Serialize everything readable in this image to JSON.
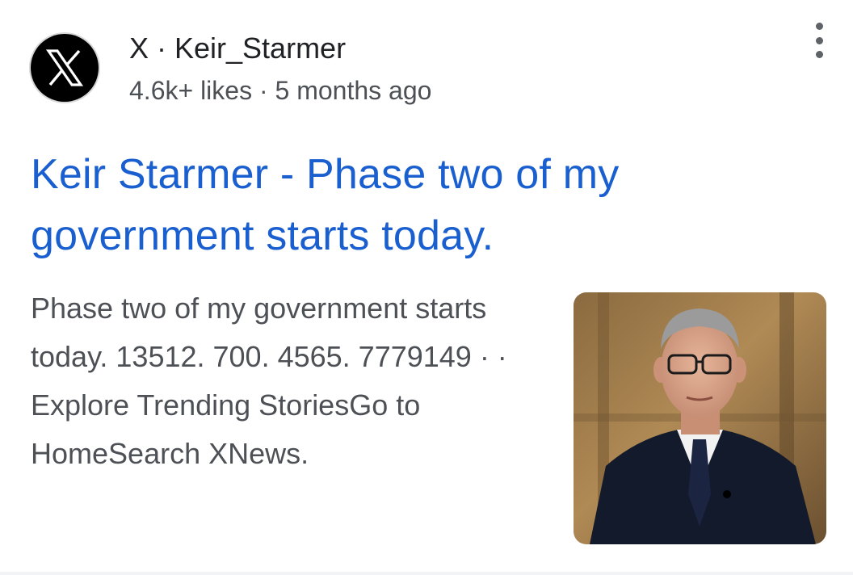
{
  "source": {
    "name": "X · Keir_Starmer",
    "meta": "4.6k+ likes · 5 months ago",
    "favicon_icon": "x-logo-icon"
  },
  "result": {
    "title": "Keir Starmer - Phase two of my government starts today.",
    "snippet": "Phase two of my government starts today. 13512. 700. 4565. 7779149 · · Explore Trending StoriesGo to HomeSearch XNews.",
    "thumbnail": "man-in-dark-suit-photo"
  },
  "menu": {
    "icon": "more-vertical-icon"
  },
  "colors": {
    "title_link": "#1a5fd0",
    "text_primary": "#202124",
    "text_secondary": "#4d5156",
    "icon_gray": "#5f6368"
  }
}
